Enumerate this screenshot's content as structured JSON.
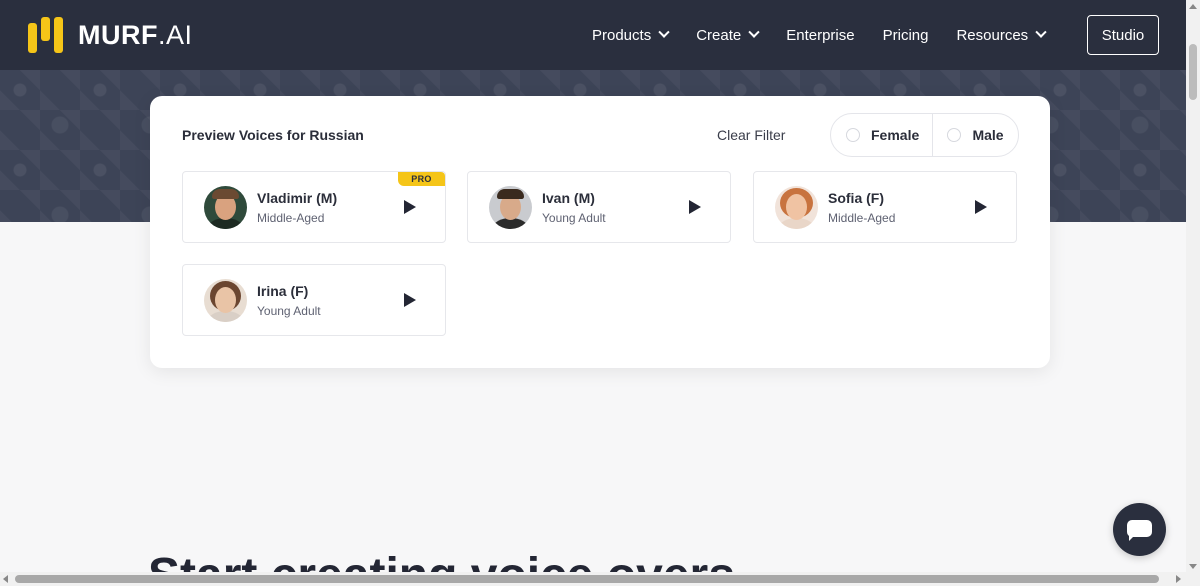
{
  "header": {
    "logo": {
      "brand_bold": "MURF",
      "brand_suffix": ".AI"
    },
    "nav": [
      {
        "label": "Products",
        "has_dropdown": true
      },
      {
        "label": "Create",
        "has_dropdown": true
      },
      {
        "label": "Enterprise",
        "has_dropdown": false
      },
      {
        "label": "Pricing",
        "has_dropdown": false
      },
      {
        "label": "Resources",
        "has_dropdown": true
      }
    ],
    "studio_label": "Studio"
  },
  "preview": {
    "title": "Preview Voices for Russian",
    "clear_filter_label": "Clear Filter",
    "gender_filters": [
      {
        "label": "Female",
        "selected": false
      },
      {
        "label": "Male",
        "selected": false
      }
    ],
    "voices": [
      {
        "name": "Vladimir (M)",
        "age": "Middle-Aged",
        "badge": "PRO"
      },
      {
        "name": "Ivan (M)",
        "age": "Young Adult"
      },
      {
        "name": "Sofia (F)",
        "age": "Middle-Aged"
      },
      {
        "name": "Irina (F)",
        "age": "Young Adult"
      }
    ]
  },
  "bottom_heading": "Start creating voice overs",
  "colors": {
    "header_bg": "#2a2f3e",
    "brand_accent": "#f5c518",
    "banner_bg": "#3d4457",
    "page_bg": "#f7f7f8"
  },
  "icons": {
    "logo_mark": "murf-logo-icon",
    "dropdown": "chevron-down-icon",
    "play": "play-icon",
    "chat": "chat-icon",
    "radio": "radio-icon"
  }
}
